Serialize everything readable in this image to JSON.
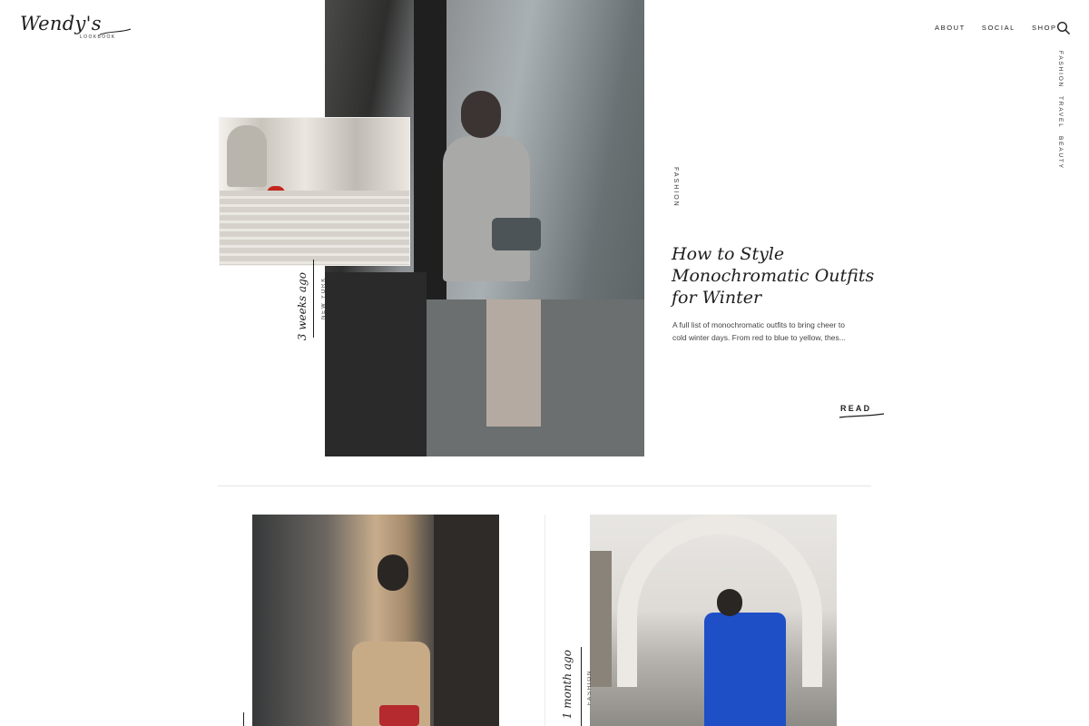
{
  "header": {
    "logo_script": "Wendy's",
    "logo_sub": "LOOKBOOK",
    "nav": [
      "ABOUT",
      "SOCIAL",
      "SHOP"
    ],
    "search_icon": "search-icon"
  },
  "side_categories": [
    "FASHION",
    "TRAVEL",
    "BEAUTY"
  ],
  "featured": {
    "date": "3 weeks ago",
    "location": "NEW YORK",
    "category": "FASHION",
    "title": "How to Style Monochromatic Outfits for Winter",
    "excerpt": "A full list of monochromatic outfits to bring cheer to cold winter days.  From red to blue to yellow, thes...",
    "read_label": "READ"
  },
  "cards": [
    {
      "date": "",
      "category": ""
    },
    {
      "date": "1 month ago",
      "category": "FASHION"
    }
  ],
  "colors": {
    "text": "#1e1e1e",
    "divider": "#e6e6e6",
    "accent_blue": "#1f4fc7"
  }
}
